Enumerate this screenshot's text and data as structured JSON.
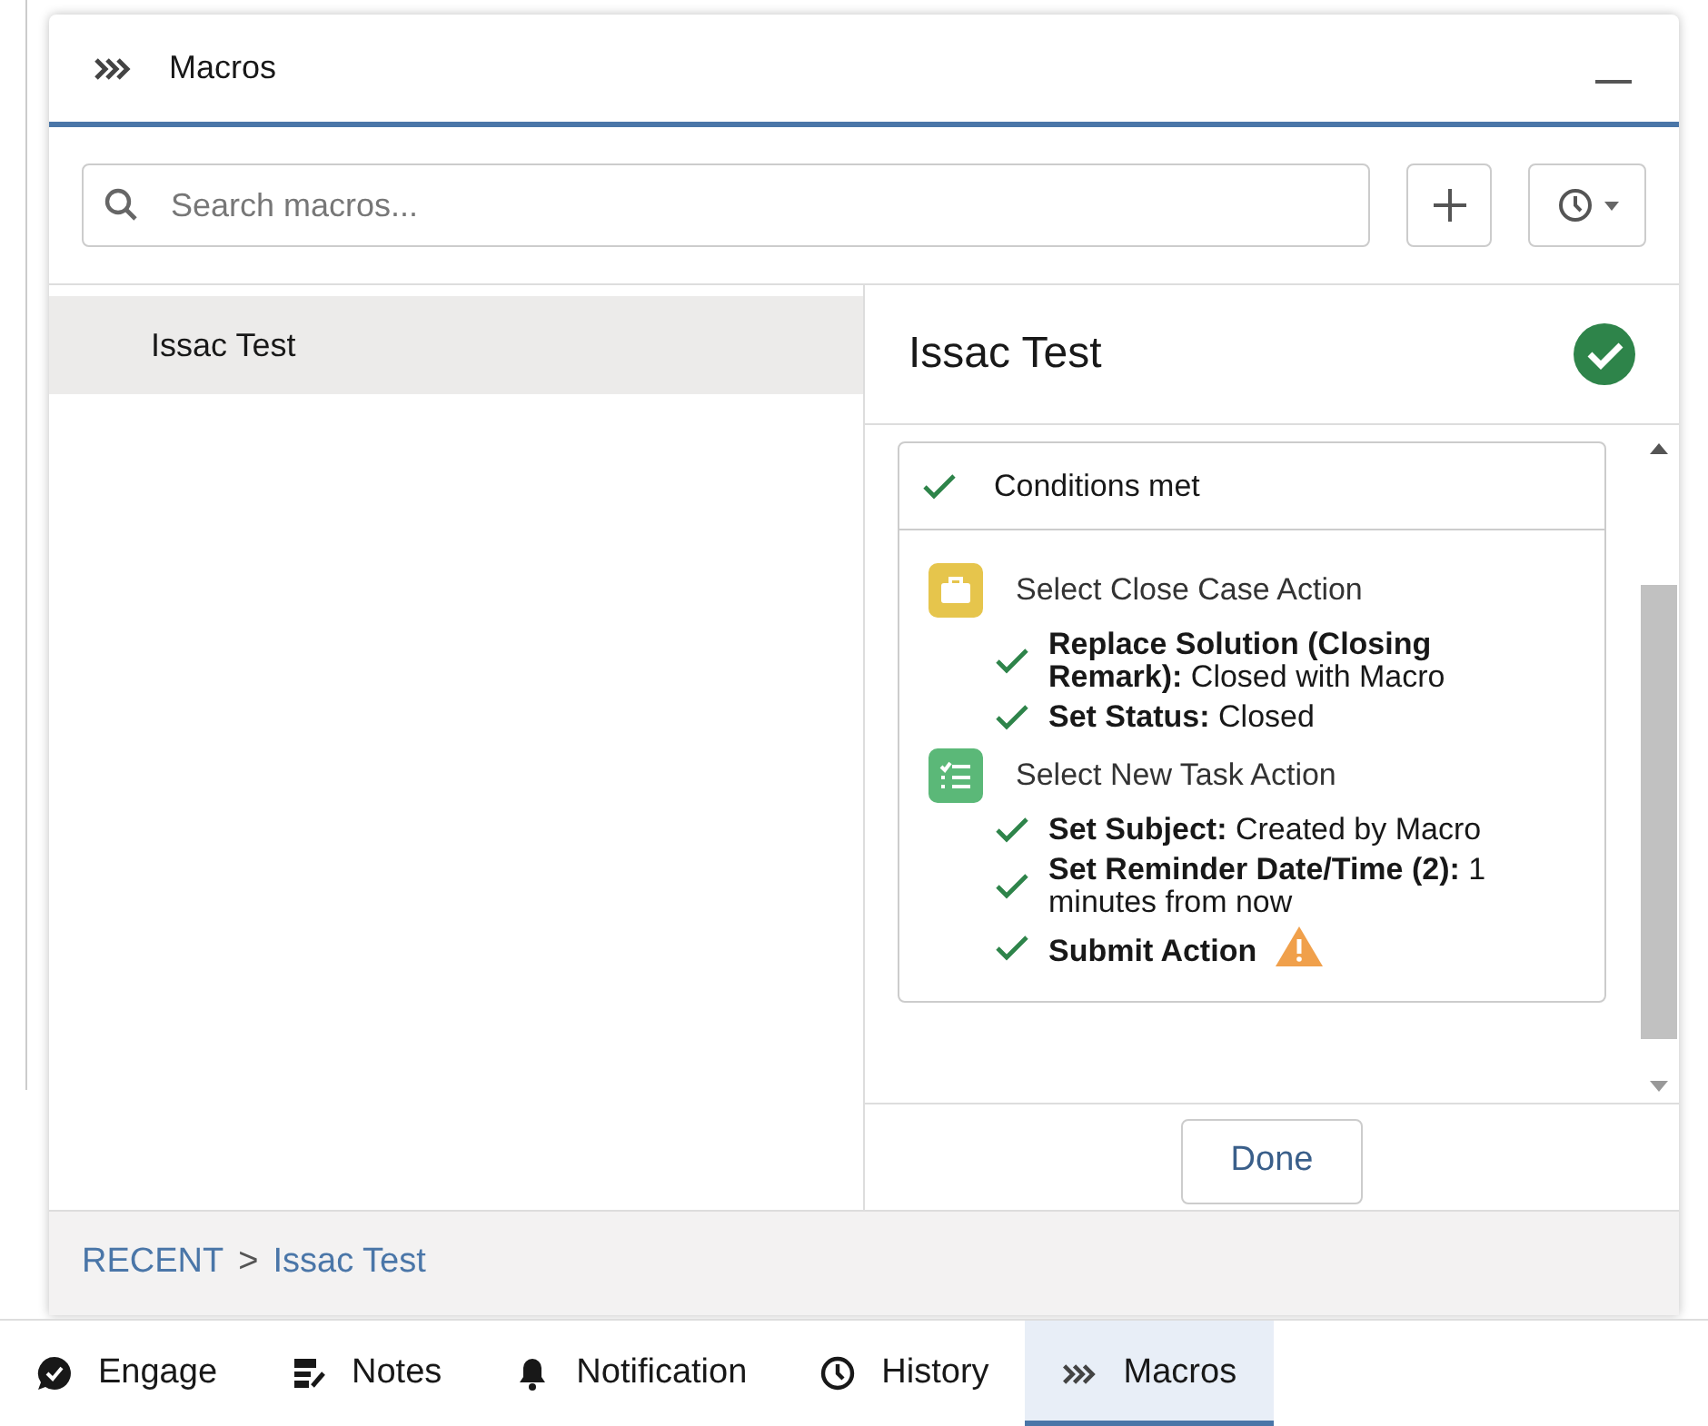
{
  "panel": {
    "title": "Macros",
    "search": {
      "placeholder": "Search macros..."
    },
    "list": [
      {
        "label": "Issac Test",
        "selected": true
      }
    ],
    "detail": {
      "title": "Issac Test",
      "conditions": "Conditions met",
      "actions": [
        {
          "kind": "close-case",
          "title": "Select Close Case Action",
          "steps": [
            {
              "text": "**Replace Solution (Closing Remark):** Closed with Macro",
              "warning": false
            },
            {
              "text": "**Set Status:** Closed",
              "warning": false
            }
          ]
        },
        {
          "kind": "task",
          "title": "Select New Task Action",
          "steps": [
            {
              "text": "**Set Subject:** Created by Macro",
              "warning": false
            },
            {
              "text": "**Set Reminder Date/Time (2):** 1 minutes from now",
              "warning": false
            },
            {
              "text": "**Submit Action**",
              "warning": true
            }
          ]
        }
      ],
      "done": "Done"
    },
    "breadcrumb": [
      "RECENT",
      ">",
      "Issac Test"
    ]
  },
  "utility_bar": [
    {
      "kind": "engage",
      "label": "Engage",
      "selected": false
    },
    {
      "kind": "notes",
      "label": "Notes",
      "selected": false
    },
    {
      "kind": "notification",
      "label": "Notification",
      "selected": false
    },
    {
      "kind": "history",
      "label": "History",
      "selected": false
    },
    {
      "kind": "macros",
      "label": "Macros",
      "selected": true
    }
  ]
}
